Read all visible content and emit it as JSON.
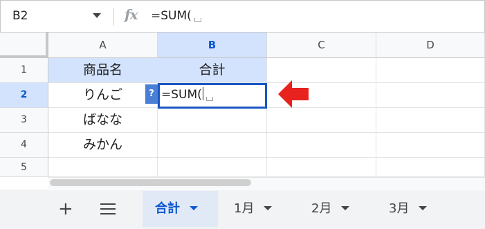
{
  "formula_bar": {
    "name_box": "B2",
    "fx_symbol": "fx",
    "formula": "=SUM("
  },
  "columns": [
    "A",
    "B",
    "C",
    "D"
  ],
  "rows": [
    "1",
    "2",
    "3",
    "4",
    "5"
  ],
  "cells": {
    "A1": "商品名",
    "B1": "合計",
    "A2": "りんご",
    "A3": "ばなな",
    "A4": "みかん"
  },
  "active_cell": {
    "ref": "B2",
    "value": "=SUM(",
    "help_badge": "?"
  },
  "sheet_tabs": {
    "add_symbol": "+",
    "tabs": [
      {
        "label": "合計",
        "active": true
      },
      {
        "label": "1月",
        "active": false
      },
      {
        "label": "2月",
        "active": false
      },
      {
        "label": "3月",
        "active": false
      }
    ]
  },
  "colors": {
    "accent": "#0b57d0",
    "selection_fill": "#d3e3fd",
    "arrow": "#e8221e"
  },
  "icons": {
    "name_box_dropdown": "caret-down-icon",
    "function": "fx-icon",
    "pointer": "red-arrow-icon",
    "all_sheets": "menu-icon"
  }
}
